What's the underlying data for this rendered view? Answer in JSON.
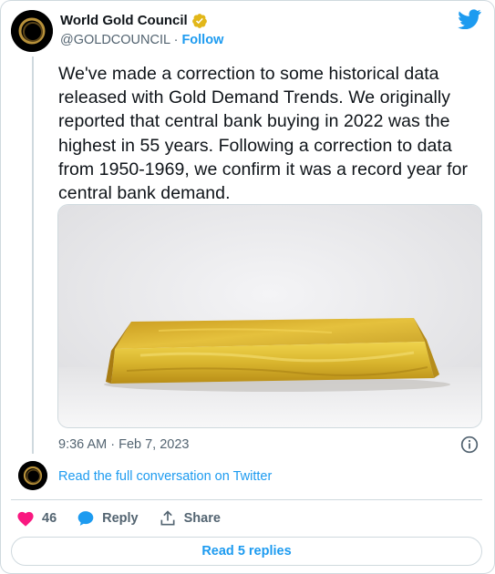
{
  "author": {
    "name": "World Gold Council",
    "handle": "@GOLDCOUNCIL",
    "separator": "·",
    "follow_label": "Follow"
  },
  "tweet": {
    "text": "We've made a correction to some historical data released with Gold Demand Trends. We originally reported that central bank buying in 2022 was the highest in 55 years. Following a correction to data from 1950-1969, we confirm it was a record year for central bank demand.",
    "timestamp": "9:36 AM · Feb 7, 2023"
  },
  "conversation": {
    "read_full_label": "Read the full conversation on Twitter"
  },
  "actions": {
    "like_count": "46",
    "reply_label": "Reply",
    "share_label": "Share"
  },
  "replies": {
    "label": "Read 5 replies"
  },
  "colors": {
    "accent": "#1d9bf0",
    "like": "#f91880",
    "verified": "#e2b719",
    "muted": "#536471"
  },
  "icons": {
    "brand": "twitter-bird-icon",
    "verified": "verified-badge-icon",
    "info": "info-icon",
    "like": "heart-icon",
    "reply": "speech-bubble-icon",
    "share": "share-arrow-icon"
  }
}
